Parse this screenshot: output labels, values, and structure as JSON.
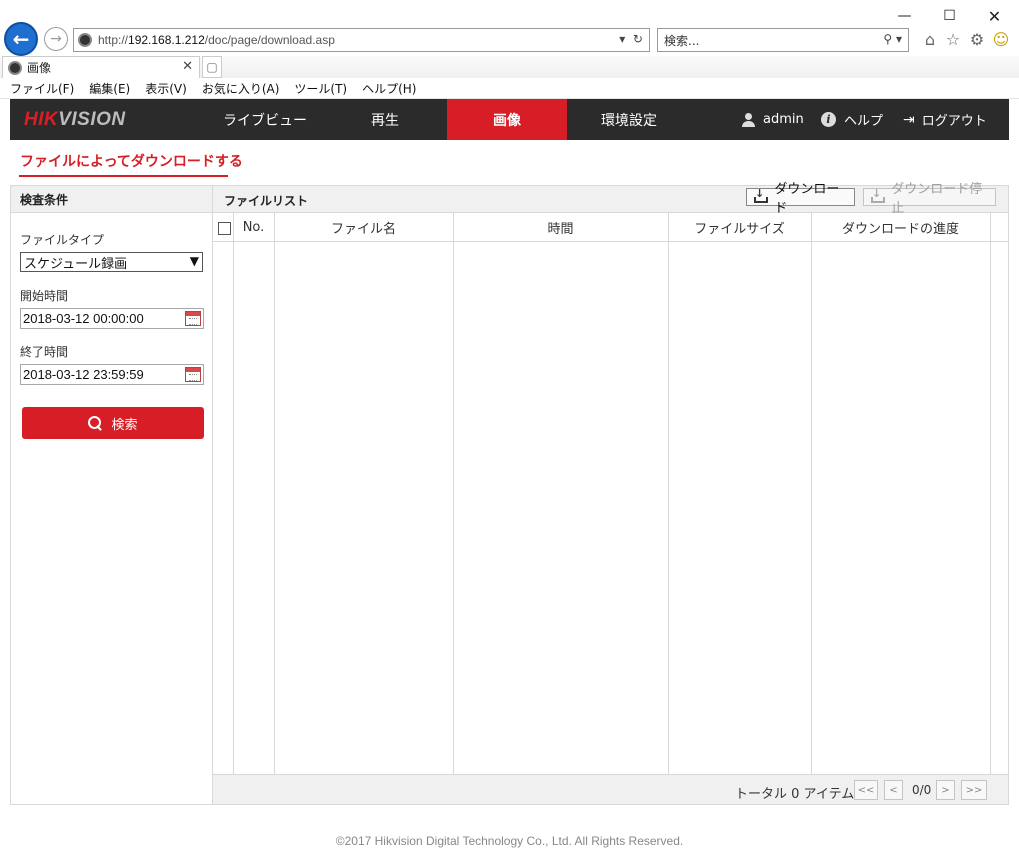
{
  "browser": {
    "url_prefix": "http://",
    "url_host": "192.168.1.212",
    "url_path": "/doc/page/download.asp",
    "search_placeholder": "検索...",
    "tab_title": "画像",
    "menu": [
      "ファイル(F)",
      "編集(E)",
      "表示(V)",
      "お気に入り(A)",
      "ツール(T)",
      "ヘルプ(H)"
    ]
  },
  "header": {
    "logo_red": "HIK",
    "logo_gray": "VISION",
    "nav": [
      "ライブビュー",
      "再生",
      "画像",
      "環境設定"
    ],
    "active_nav": "画像",
    "user": "admin",
    "help": "ヘルプ",
    "logout": "ログアウト"
  },
  "page": {
    "title": "ファイルによってダウンロードする"
  },
  "search_panel": {
    "header": "検査条件",
    "file_type_label": "ファイルタイプ",
    "file_type_value": "スケジュール録画",
    "start_label": "開始時間",
    "start_value": "2018-03-12 00:00:00",
    "end_label": "終了時間",
    "end_value": "2018-03-12 23:59:59",
    "search_button": "検索"
  },
  "file_list": {
    "header": "ファイルリスト",
    "download_button": "ダウンロード",
    "stop_download_button": "ダウンロード停止",
    "columns": [
      "No.",
      "ファイル名",
      "時間",
      "ファイルサイズ",
      "ダウンロードの進度"
    ],
    "rows": [],
    "total_text": "トータル 0 アイテム",
    "page_first": "<<",
    "page_prev": "<",
    "page_info": "0/0",
    "page_next": ">",
    "page_last": ">>"
  },
  "footer": {
    "copyright": "©2017 Hikvision Digital Technology Co., Ltd. All Rights Reserved."
  }
}
